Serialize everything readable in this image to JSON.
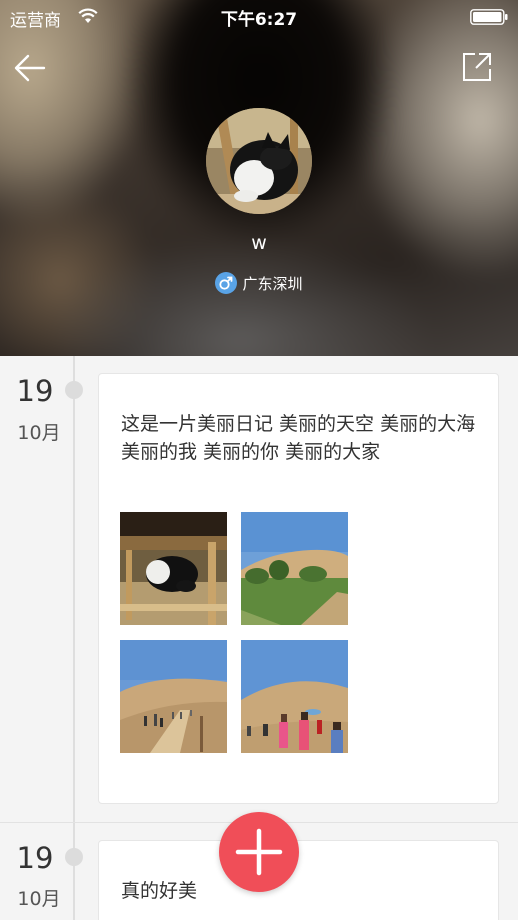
{
  "status_bar": {
    "carrier": "运营商",
    "time": "下午6:27"
  },
  "profile": {
    "username": "w",
    "location": "广东深圳",
    "gender_icon": "male-icon"
  },
  "icons": {
    "back": "back-arrow-icon",
    "share": "share-icon",
    "add": "plus-icon"
  },
  "colors": {
    "accent": "#f04e58",
    "gender_badge": "#59a3e6"
  },
  "posts": [
    {
      "day": "19",
      "month": "10月",
      "text": "这是一片美丽日记 美丽的天空 美丽的大海 美丽的我 美丽的你 美丽的大家",
      "photos": [
        "cat-photo",
        "oasis-photo",
        "desert-crowd-photo",
        "desert-people-photo"
      ]
    },
    {
      "day": "19",
      "month": "10月",
      "text": "真的好美"
    }
  ]
}
